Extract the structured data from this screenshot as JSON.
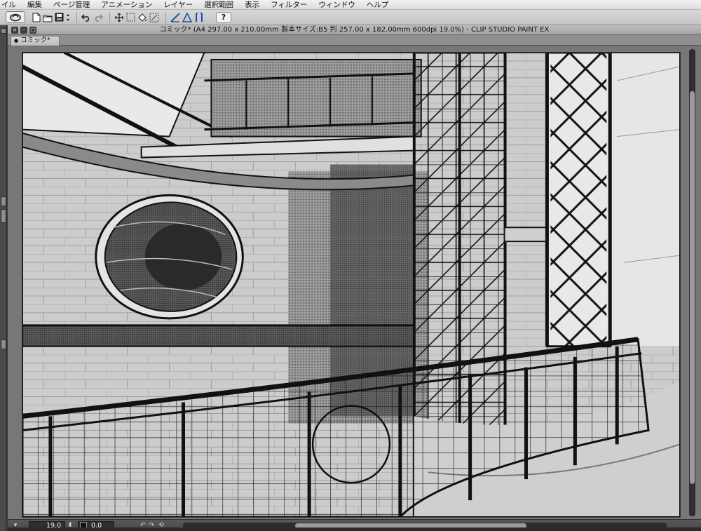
{
  "menubar": {
    "items": [
      "イル",
      "編集",
      "ページ管理",
      "アニメーション",
      "レイヤー",
      "選択範囲",
      "表示",
      "フィルター",
      "ウィンドウ",
      "ヘルプ"
    ]
  },
  "toolbar": {
    "icons": [
      "clip-studio-logo-icon",
      "new-file-icon",
      "open-file-icon",
      "save-icon",
      "undo-icon",
      "redo-icon",
      "transform-icon",
      "clear-icon",
      "fill-icon",
      "snap-to-ruler-icon",
      "snap-to-perspective-icon",
      "snap-to-grid-icon",
      "help-icon"
    ],
    "help_label": "?"
  },
  "window": {
    "title": "コミック* (A4 297.00 x 210.00mm 製本サイズ:B5 判 257.00 x 182.00mm 600dpi 19.0%)  - CLIP STUDIO PAINT EX",
    "tab_label": "コミック*"
  },
  "statusbar": {
    "zoom": "19.0",
    "rotation": "0.0"
  },
  "colors": {
    "menubar_bg": "#e6e6e6",
    "toolbar_bg": "#cccccc",
    "window_bg": "#6b6b6b",
    "canvas_ink": "#1a1a1a"
  }
}
